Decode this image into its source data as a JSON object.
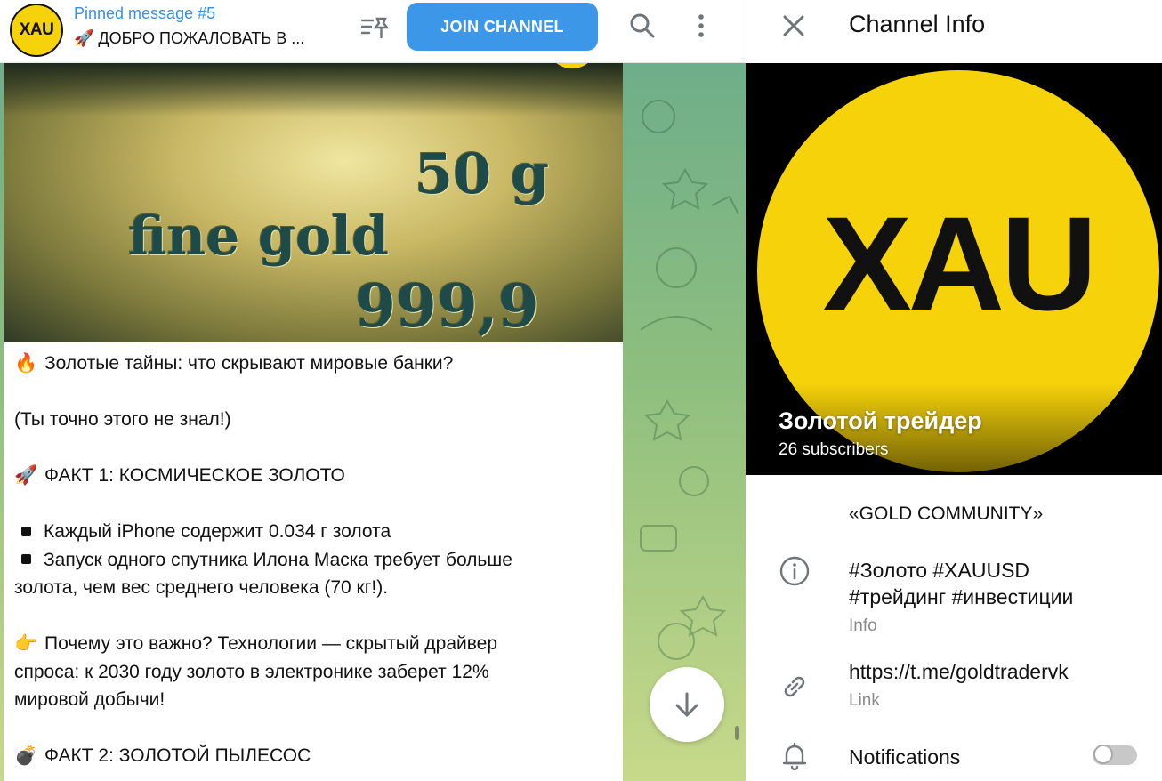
{
  "header": {
    "avatar_text": "XAU",
    "pinned_title": "Pinned message #5",
    "pinned_text": "🚀 ДОБРО ПОЖАЛОВАТЬ В ...",
    "join_label": "JOIN CHANNEL",
    "icons": [
      "pin-list-icon",
      "search-icon",
      "more-vertical-icon"
    ]
  },
  "message": {
    "photo_lines": [
      "50 g",
      "fine gold",
      "999,9"
    ],
    "lines": [
      {
        "emoji": "🔥",
        "text": "Золотые тайны: что скрывают мировые банки?"
      },
      {
        "text": "(Ты точно этого не знал!)"
      },
      {
        "emoji": "🚀",
        "text": "ФАКТ 1: КОСМИЧЕСКОЕ ЗОЛОТО"
      },
      {
        "bullet": "◾",
        "text": "Каждый iPhone содержит 0.034 г золота"
      },
      {
        "bullet": "◾",
        "text": "Запуск одного спутника Илона Маска требует больше"
      },
      {
        "text": "золота, чем вес среднего человека (70 кг!)."
      },
      {
        "emoji": "👉",
        "text": "Почему это важно? Технологии — скрытый драйвер"
      },
      {
        "text": "спроса: к 2030 году золото в электронике заберет 12%"
      },
      {
        "text": "мировой добычи!"
      },
      {
        "emoji": "💣",
        "text": "ФАКТ 2: ЗОЛОТОЙ ПЫЛЕСОС"
      }
    ]
  },
  "panel": {
    "title": "Channel Info",
    "cover_logo": "XAU",
    "channel_name": "Золотой трейдер",
    "subscribers": "26 subscribers",
    "description": "«GOLD COMMUNITY»",
    "info_line1": "#Золото #XAUUSD",
    "info_line2": "#трейдинг #инвестиции",
    "info_label": "Info",
    "link": "https://t.me/goldtradervk",
    "link_label": "Link",
    "notifications_label": "Notifications",
    "notifications_on": false
  },
  "colors": {
    "accent": "#3390ec",
    "join_button": "#3d97e8",
    "gold": "#f5d20a"
  }
}
